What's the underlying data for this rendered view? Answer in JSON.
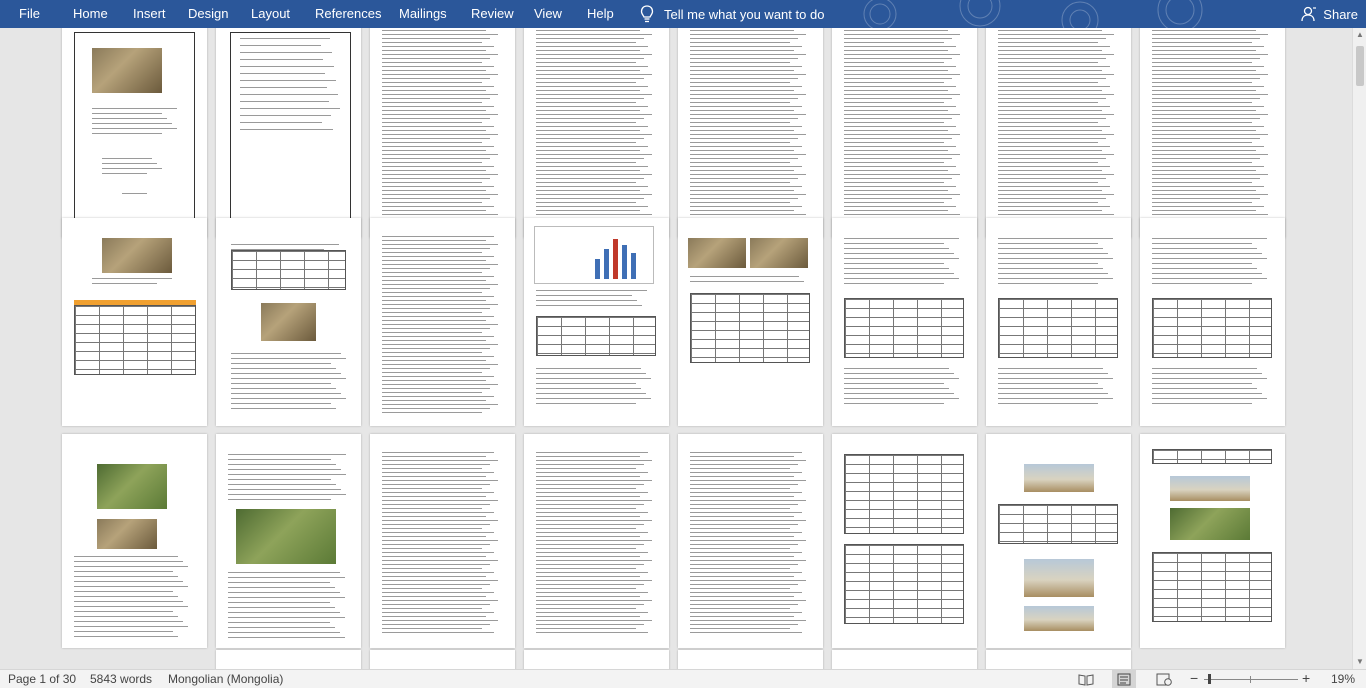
{
  "menubar": {
    "tabs": [
      "File",
      "Home",
      "Insert",
      "Design",
      "Layout",
      "References",
      "Mailings",
      "Review",
      "View",
      "Help"
    ],
    "tell_me": "Tell me what you want to do",
    "share": "Share",
    "bg_color": "#2b579a"
  },
  "status": {
    "page": "Page 1 of 30",
    "words": "5843 words",
    "language": "Mongolian (Mongolia)",
    "zoom": "19%"
  },
  "icons": {
    "lightbulb": "lightbulb-icon",
    "person": "person-icon",
    "read_mode": "read-mode-icon",
    "print_layout": "print-layout-icon",
    "web_layout": "web-layout-icon"
  }
}
